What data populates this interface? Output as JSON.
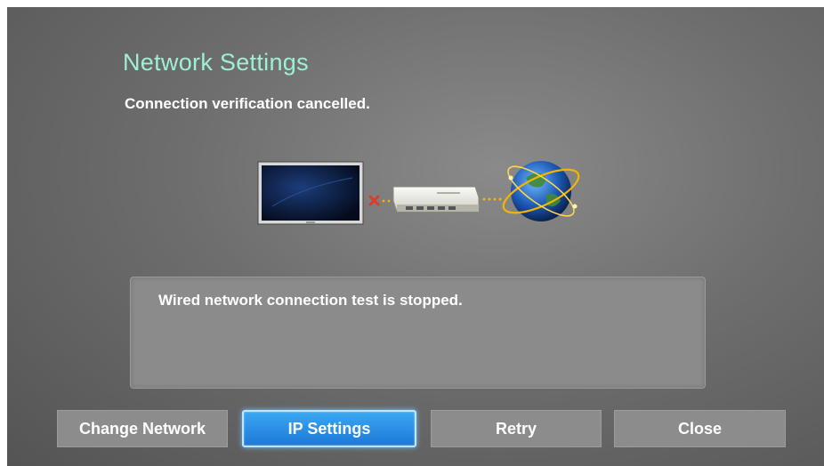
{
  "dialog": {
    "title": "Network Settings",
    "status": "Connection verification cancelled.",
    "message": "Wired network connection test is stopped."
  },
  "diagram": {
    "devices": [
      "tv-icon",
      "router-icon",
      "globe-icon"
    ],
    "tv_to_router_link": "failed",
    "router_to_internet_link": "connected"
  },
  "buttons": [
    {
      "label": "Change Network",
      "focused": false
    },
    {
      "label": "IP Settings",
      "focused": true
    },
    {
      "label": "Retry",
      "focused": false
    },
    {
      "label": "Close",
      "focused": false
    }
  ],
  "colors": {
    "title": "#9df0d2",
    "focus_button": "#1e78d6",
    "failed_link": "#e03a2a",
    "connected_link": "#f5b400"
  }
}
